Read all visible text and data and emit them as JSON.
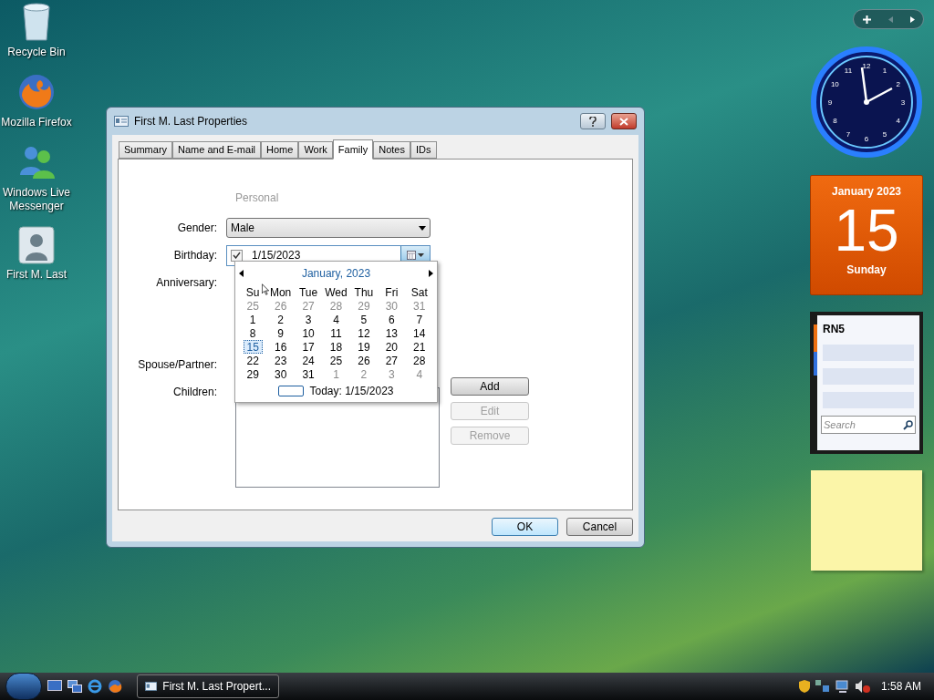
{
  "desktop_icons": [
    {
      "label": "Recycle Bin",
      "kind": "recycle"
    },
    {
      "label": "Mozilla Firefox",
      "kind": "firefox"
    },
    {
      "label": "Windows Live Messenger",
      "kind": "messenger"
    },
    {
      "label": "First M. Last",
      "kind": "contact"
    }
  ],
  "dialog": {
    "title": "First M. Last Properties",
    "tabs": [
      {
        "label": "Summary",
        "selected": false
      },
      {
        "label": "Name and E-mail",
        "selected": false
      },
      {
        "label": "Home",
        "selected": false
      },
      {
        "label": "Work",
        "selected": false
      },
      {
        "label": "Family",
        "selected": true
      },
      {
        "label": "Notes",
        "selected": false
      },
      {
        "label": "IDs",
        "selected": false
      }
    ],
    "section_label": "Personal",
    "gender": {
      "label": "Gender:",
      "value": "Male"
    },
    "birthday": {
      "label": "Birthday:",
      "checked": true,
      "value": "1/15/2023"
    },
    "anniversary": {
      "label": "Anniversary:"
    },
    "spouse": {
      "label": "Spouse/Partner:"
    },
    "children": {
      "label": "Children:",
      "buttons": [
        {
          "label": "Add",
          "disabled": false
        },
        {
          "label": "Edit",
          "disabled": true
        },
        {
          "label": "Remove",
          "disabled": true
        }
      ]
    },
    "calendar": {
      "month_title": "January, 2023",
      "weekdays": [
        "Su",
        "Mon",
        "Tue",
        "Wed",
        "Thu",
        "Fri",
        "Sat"
      ],
      "weeks": [
        [
          {
            "label": "25",
            "in_month": false,
            "selected": false
          },
          {
            "label": "26",
            "in_month": false,
            "selected": false
          },
          {
            "label": "27",
            "in_month": false,
            "selected": false
          },
          {
            "label": "28",
            "in_month": false,
            "selected": false
          },
          {
            "label": "29",
            "in_month": false,
            "selected": false
          },
          {
            "label": "30",
            "in_month": false,
            "selected": false
          },
          {
            "label": "31",
            "in_month": false,
            "selected": false
          }
        ],
        [
          {
            "label": "1",
            "in_month": true,
            "selected": false
          },
          {
            "label": "2",
            "in_month": true,
            "selected": false
          },
          {
            "label": "3",
            "in_month": true,
            "selected": false
          },
          {
            "label": "4",
            "in_month": true,
            "selected": false
          },
          {
            "label": "5",
            "in_month": true,
            "selected": false
          },
          {
            "label": "6",
            "in_month": true,
            "selected": false
          },
          {
            "label": "7",
            "in_month": true,
            "selected": false
          }
        ],
        [
          {
            "label": "8",
            "in_month": true,
            "selected": false
          },
          {
            "label": "9",
            "in_month": true,
            "selected": false
          },
          {
            "label": "10",
            "in_month": true,
            "selected": false
          },
          {
            "label": "11",
            "in_month": true,
            "selected": false
          },
          {
            "label": "12",
            "in_month": true,
            "selected": false
          },
          {
            "label": "13",
            "in_month": true,
            "selected": false
          },
          {
            "label": "14",
            "in_month": true,
            "selected": false
          }
        ],
        [
          {
            "label": "15",
            "in_month": true,
            "selected": true
          },
          {
            "label": "16",
            "in_month": true,
            "selected": false
          },
          {
            "label": "17",
            "in_month": true,
            "selected": false
          },
          {
            "label": "18",
            "in_month": true,
            "selected": false
          },
          {
            "label": "19",
            "in_month": true,
            "selected": false
          },
          {
            "label": "20",
            "in_month": true,
            "selected": false
          },
          {
            "label": "21",
            "in_month": true,
            "selected": false
          }
        ],
        [
          {
            "label": "22",
            "in_month": true,
            "selected": false
          },
          {
            "label": "23",
            "in_month": true,
            "selected": false
          },
          {
            "label": "24",
            "in_month": true,
            "selected": false
          },
          {
            "label": "25",
            "in_month": true,
            "selected": false
          },
          {
            "label": "26",
            "in_month": true,
            "selected": false
          },
          {
            "label": "27",
            "in_month": true,
            "selected": false
          },
          {
            "label": "28",
            "in_month": true,
            "selected": false
          }
        ],
        [
          {
            "label": "29",
            "in_month": true,
            "selected": false
          },
          {
            "label": "30",
            "in_month": true,
            "selected": false
          },
          {
            "label": "31",
            "in_month": true,
            "selected": false
          },
          {
            "label": "1",
            "in_month": false,
            "selected": false
          },
          {
            "label": "2",
            "in_month": false,
            "selected": false
          },
          {
            "label": "3",
            "in_month": false,
            "selected": false
          },
          {
            "label": "4",
            "in_month": false,
            "selected": false
          }
        ]
      ],
      "today_label": "Today: 1/15/2023"
    },
    "footer_buttons": [
      {
        "label": "OK",
        "default": true
      },
      {
        "label": "Cancel",
        "default": false
      }
    ]
  },
  "gadgets": {
    "clock_numerals": [
      "12",
      "1",
      "2",
      "3",
      "4",
      "5",
      "6",
      "7",
      "8",
      "9",
      "10",
      "11"
    ],
    "calendar": {
      "month": "January 2023",
      "day": "15",
      "weekday": "Sunday"
    },
    "notes": {
      "title": "RN5",
      "search_placeholder": "Search"
    }
  },
  "taskbar": {
    "task": "First M. Last Propert...",
    "time": "1:58 AM"
  }
}
